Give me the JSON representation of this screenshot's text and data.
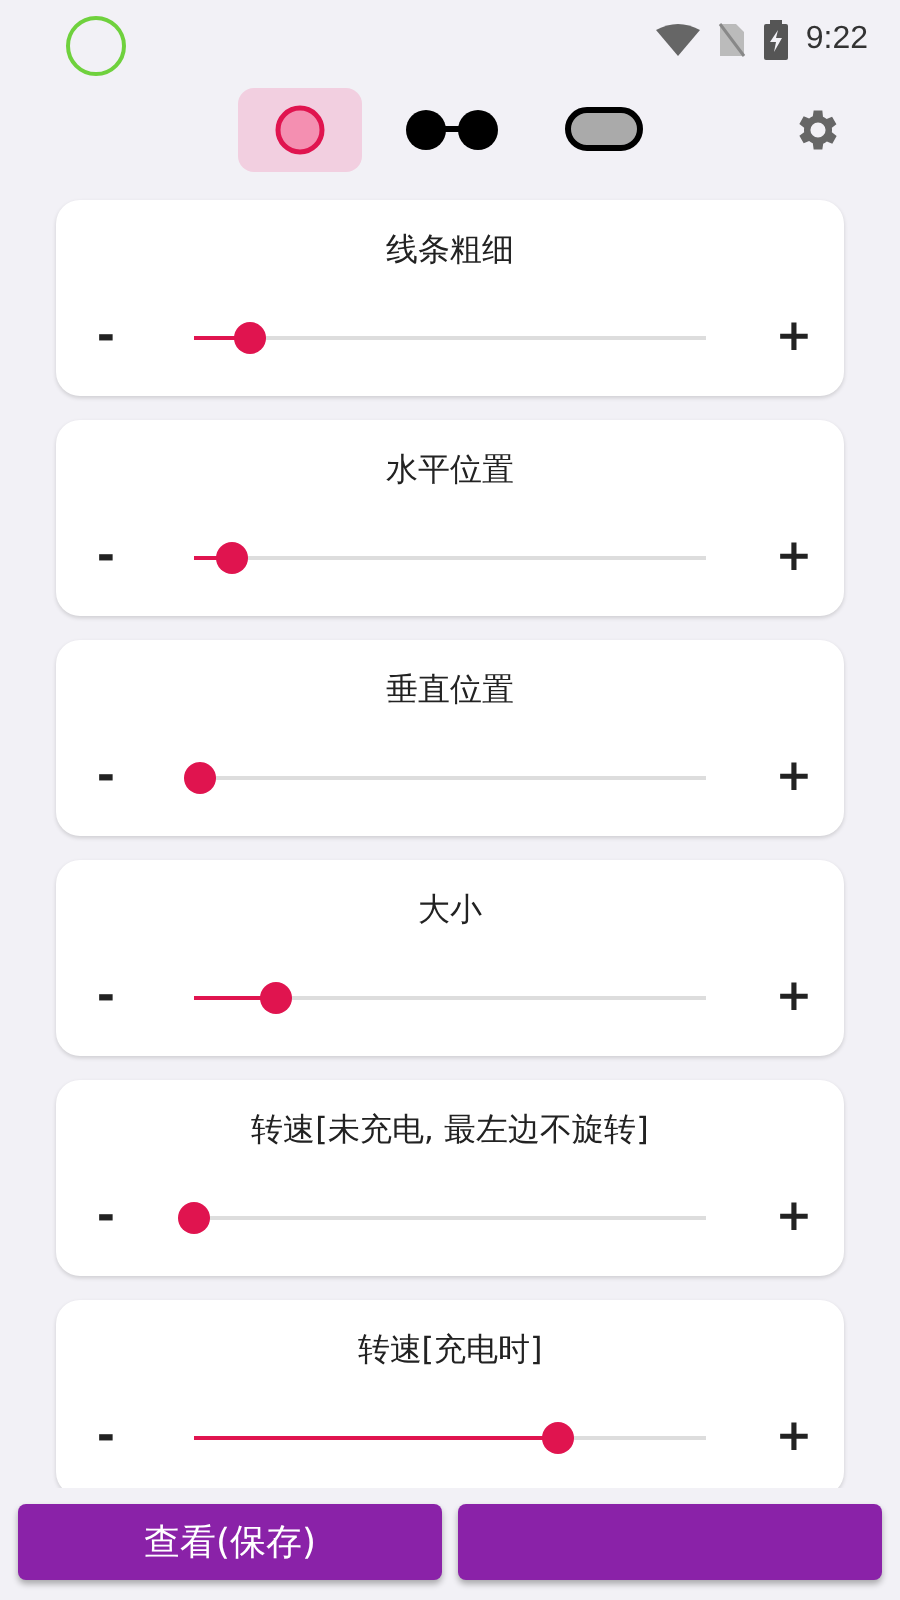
{
  "status_bar": {
    "time": "9:22"
  },
  "modes": [
    {
      "kind": "ring",
      "selected": true
    },
    {
      "kind": "glasses",
      "selected": false
    },
    {
      "kind": "pill",
      "selected": false
    }
  ],
  "settings": [
    {
      "title": "线条粗细",
      "minus": "-",
      "plus": "+",
      "level": 0.11
    },
    {
      "title": "水平位置",
      "minus": "-",
      "plus": "+",
      "level": 0.075
    },
    {
      "title": "垂直位置",
      "minus": "-",
      "plus": "+",
      "level": 0.01
    },
    {
      "title": "大小",
      "minus": "-",
      "plus": "+",
      "level": 0.16
    },
    {
      "title": "转速[未充电, 最左边不旋转]",
      "minus": "-",
      "plus": "+",
      "level": 0
    },
    {
      "title": "转速[充电时]",
      "minus": "-",
      "plus": "+",
      "level": 0.71
    }
  ],
  "buttons": [
    {
      "kind": "text",
      "label": "查看(保存)"
    },
    {
      "kind": "blank"
    }
  ]
}
